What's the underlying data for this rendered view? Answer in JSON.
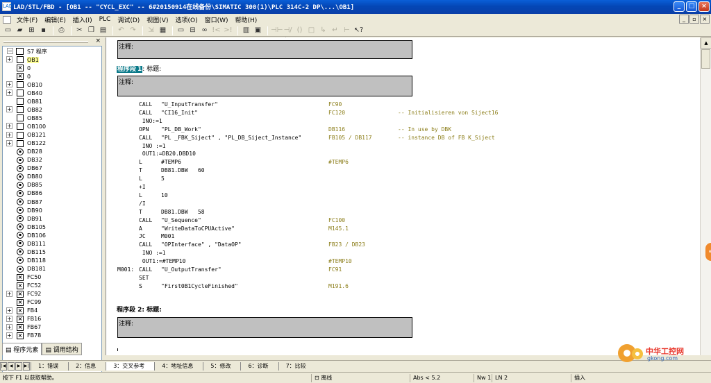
{
  "window": {
    "title": "LAD/STL/FBD  - [OB1 -- \"CYCL_EXC\" -- 6#20150914在线备份\\SIMATIC 300(1)\\PLC 314C-2 DP\\...\\OB1]",
    "app_icon_text": "LAD"
  },
  "menu": [
    "文件(F)",
    "编辑(E)",
    "插入(I)",
    "PLC",
    "调试(D)",
    "视图(V)",
    "选项(O)",
    "窗口(W)",
    "帮助(H)"
  ],
  "tree": {
    "root_label": "S7 程序",
    "items": [
      {
        "label": "OB1",
        "icon": "box",
        "expander": true,
        "selected": true
      },
      {
        "label": "0",
        "icon": "x",
        "expander": false
      },
      {
        "label": "0",
        "icon": "x",
        "expander": false
      },
      {
        "label": "OB10",
        "icon": "box",
        "expander": true
      },
      {
        "label": "OB40",
        "icon": "box",
        "expander": true
      },
      {
        "label": "OB81",
        "icon": "box",
        "expander": false
      },
      {
        "label": "OB82",
        "icon": "box",
        "expander": true
      },
      {
        "label": "OB85",
        "icon": "box",
        "expander": false
      },
      {
        "label": "OB100",
        "icon": "box",
        "expander": true
      },
      {
        "label": "OB121",
        "icon": "box",
        "expander": true
      },
      {
        "label": "OB122",
        "icon": "box",
        "expander": true
      },
      {
        "label": "DB28",
        "icon": "db",
        "expander": false
      },
      {
        "label": "DB32",
        "icon": "db",
        "expander": false
      },
      {
        "label": "DB67",
        "icon": "db",
        "expander": false
      },
      {
        "label": "DB80",
        "icon": "db",
        "expander": false
      },
      {
        "label": "DB85",
        "icon": "db",
        "expander": false
      },
      {
        "label": "DB86",
        "icon": "db",
        "expander": false
      },
      {
        "label": "DB87",
        "icon": "db",
        "expander": false
      },
      {
        "label": "DB90",
        "icon": "db",
        "expander": false
      },
      {
        "label": "DB91",
        "icon": "db",
        "expander": false
      },
      {
        "label": "DB105",
        "icon": "db",
        "expander": false
      },
      {
        "label": "DB106",
        "icon": "db",
        "expander": false
      },
      {
        "label": "DB111",
        "icon": "db",
        "expander": false
      },
      {
        "label": "DB115",
        "icon": "db",
        "expander": false
      },
      {
        "label": "DB118",
        "icon": "db",
        "expander": false
      },
      {
        "label": "DB181",
        "icon": "db",
        "expander": false
      },
      {
        "label": "FC50",
        "icon": "x",
        "expander": false
      },
      {
        "label": "FC52",
        "icon": "x",
        "expander": false
      },
      {
        "label": "FC92",
        "icon": "x",
        "expander": true
      },
      {
        "label": "FC99",
        "icon": "x",
        "expander": false
      },
      {
        "label": "FB4",
        "icon": "x",
        "expander": true
      },
      {
        "label": "FB16",
        "icon": "x",
        "expander": true
      },
      {
        "label": "FB67",
        "icon": "x",
        "expander": true
      },
      {
        "label": "FB78",
        "icon": "x",
        "expander": true
      }
    ],
    "tabs": [
      "程序元素",
      "调用结构"
    ]
  },
  "editor": {
    "comment_label": "注释:",
    "network1": {
      "prefix": "程序段",
      "number": "1",
      "title": ": 标题:"
    },
    "network2": {
      "title": "程序段 2: 标题:"
    },
    "code": [
      {
        "label": "",
        "instr": "CALL",
        "op": "\"U_InputTransfer\"",
        "sym": "FC90",
        "cmt": ""
      },
      {
        "label": "",
        "instr": "CALL",
        "op": "\"CI16_Init\"",
        "sym": "FC120",
        "cmt": "-- Initialisieren von Siject16"
      },
      {
        "label": "",
        "instr": " INO:=1",
        "op": "",
        "sym": "",
        "cmt": ""
      },
      {
        "label": "",
        "instr": "OPN",
        "op": "\"PL_DB_Work\"",
        "sym": "DB116",
        "cmt": "-- In use by DBK"
      },
      {
        "label": "",
        "instr": "CALL",
        "op": "\"PL _FBK_Siject\" , \"PL_DB_Siject_Instance\"",
        "sym": "FB105 / DB117",
        "cmt": "-- instance DB of FB K_Siject"
      },
      {
        "label": "",
        "instr": " INO :=1",
        "op": "",
        "sym": "",
        "cmt": ""
      },
      {
        "label": "",
        "instr": " OUT1:=DB20.DBD10",
        "op": "",
        "sym": "",
        "cmt": ""
      },
      {
        "label": "",
        "instr": "L",
        "op": "#TEMP6",
        "sym": "#TEMP6",
        "cmt": ""
      },
      {
        "label": "",
        "instr": "T",
        "op": "DB81.DBW   60",
        "sym": "",
        "cmt": ""
      },
      {
        "label": "",
        "instr": "L",
        "op": "5",
        "sym": "",
        "cmt": ""
      },
      {
        "label": "",
        "instr": "+I",
        "op": "",
        "sym": "",
        "cmt": ""
      },
      {
        "label": "",
        "instr": "L",
        "op": "10",
        "sym": "",
        "cmt": ""
      },
      {
        "label": "",
        "instr": "/I",
        "op": "",
        "sym": "",
        "cmt": ""
      },
      {
        "label": "",
        "instr": "T",
        "op": "DB81.DBW   58",
        "sym": "",
        "cmt": ""
      },
      {
        "label": "",
        "instr": "CALL",
        "op": "\"U_Sequence\"",
        "sym": "FC100",
        "cmt": ""
      },
      {
        "label": "",
        "instr": "A",
        "op": "\"WriteDataToCPUActive\"",
        "sym": "M145.1",
        "cmt": ""
      },
      {
        "label": "",
        "instr": "JC",
        "op": "M001",
        "sym": "",
        "cmt": ""
      },
      {
        "label": "",
        "instr": "CALL",
        "op": "\"OPInterface\" , \"DataOP\"",
        "sym": "FB23 / DB23",
        "cmt": ""
      },
      {
        "label": "",
        "instr": " INO :=1",
        "op": "",
        "sym": "",
        "cmt": ""
      },
      {
        "label": "",
        "instr": " OUT1:=#TEMP10",
        "op": "",
        "sym": "#TEMP10",
        "cmt": ""
      },
      {
        "label": "M001:",
        "instr": "CALL",
        "op": "\"U_OutputTransfer\"",
        "sym": "FC91",
        "cmt": ""
      },
      {
        "label": "",
        "instr": "SET",
        "op": "",
        "sym": "",
        "cmt": ""
      },
      {
        "label": "",
        "instr": "S",
        "op": "\"First0B1CycleFinished\"",
        "sym": "M191.6",
        "cmt": ""
      }
    ]
  },
  "bottom_tabs": [
    "1：错误",
    "2：信息",
    "3：交叉参考",
    "4：地址信息",
    "5：修改",
    "6：诊断",
    "7：比较"
  ],
  "statusbar": {
    "help": "按下 F1 以获取帮助。",
    "mode": "离线",
    "abs": "Abs < 5.2",
    "nw": "Nw 1",
    "ln": "LN 2",
    "ins": "插入"
  },
  "watermark": {
    "cn": "中华工控网",
    "en": "gkong.com"
  }
}
